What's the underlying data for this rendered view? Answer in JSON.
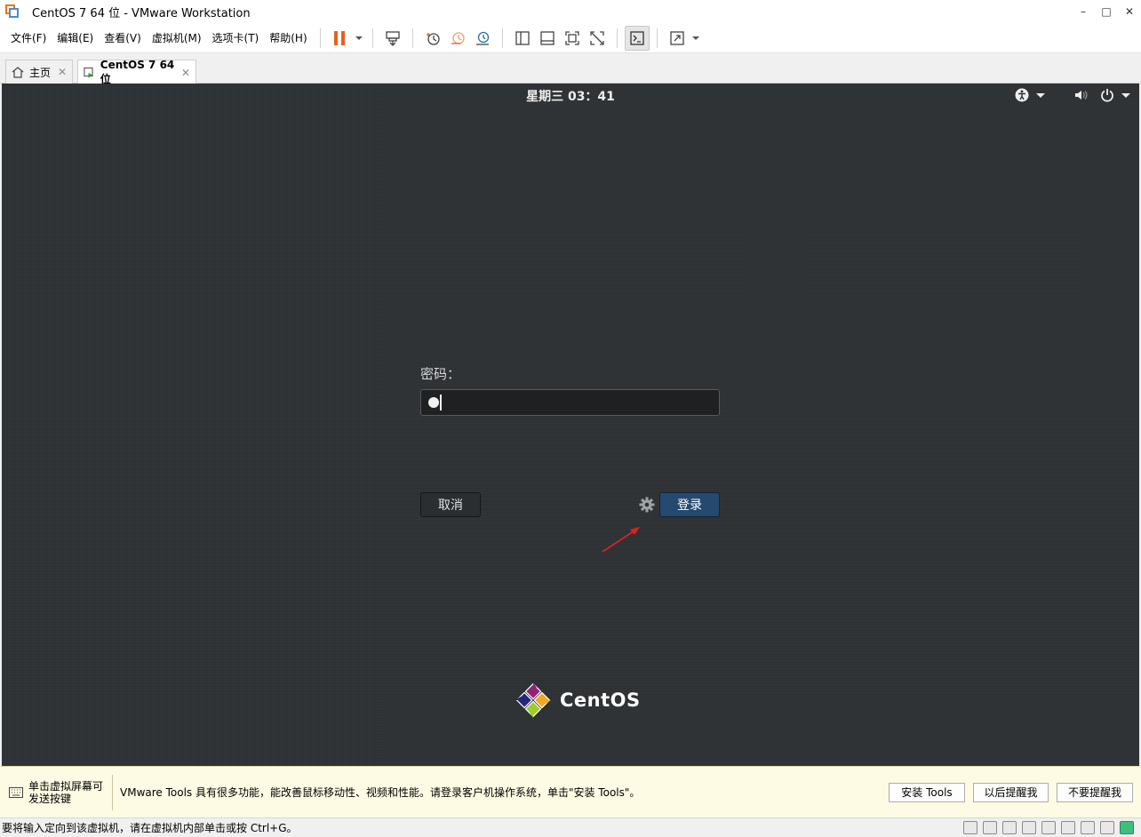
{
  "window": {
    "title": "CentOS 7 64 位 - VMware Workstation",
    "minimize": "–",
    "maximize": "□",
    "close": "✕"
  },
  "menu": {
    "items": [
      "文件(F)",
      "编辑(E)",
      "查看(V)",
      "虚拟机(M)",
      "选项卡(T)",
      "帮助(H)"
    ]
  },
  "toolbar": {
    "icons": [
      "pause-icon",
      "send-ctrl-alt-del-icon",
      "snapshot-icon",
      "revert-snapshot-icon",
      "snapshot-manager-icon",
      "sidebar-icon",
      "thumbnail-icon",
      "fullscreen-icon",
      "unity-icon",
      "console-icon",
      "stretch-icon"
    ],
    "pause_color": "#e8601c"
  },
  "tabs": [
    {
      "label": "主页",
      "active": false
    },
    {
      "label": "CentOS 7 64 位",
      "active": true
    }
  ],
  "guest": {
    "clock": "星期三 03：41",
    "password_label": "密码：",
    "cancel_label": "取消",
    "login_label": "登录",
    "brand": "CentOS",
    "bg_color": "#2e3134",
    "login_color": "#25496f"
  },
  "notification": {
    "hint": "单击虚拟屏幕可发送按键",
    "message": "VMware Tools 具有很多功能，能改善鼠标移动性、视频和性能。请登录客户机操作系统，单击\"安装 Tools\"。",
    "buttons": [
      "安装 Tools",
      "以后提醒我",
      "不要提醒我"
    ]
  },
  "status": {
    "text": "要将输入定向到该虚拟机，请在虚拟机内部单击或按 Ctrl+G。"
  }
}
